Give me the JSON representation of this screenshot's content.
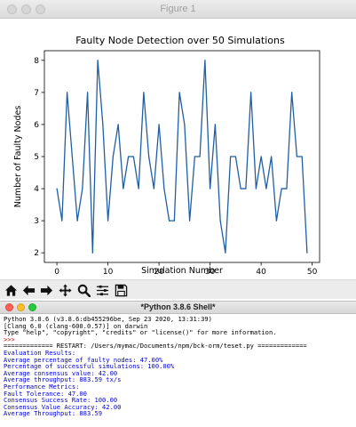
{
  "figure_window": {
    "title": "Figure 1",
    "toolbar": {
      "buttons": [
        {
          "name": "home-icon",
          "label": "Home"
        },
        {
          "name": "back-arrow-icon",
          "label": "Back"
        },
        {
          "name": "forward-arrow-icon",
          "label": "Forward"
        },
        {
          "name": "pan-icon",
          "label": "Pan"
        },
        {
          "name": "zoom-icon",
          "label": "Zoom"
        },
        {
          "name": "configure-subplots-icon",
          "label": "Configure subplots"
        },
        {
          "name": "save-icon",
          "label": "Save"
        }
      ]
    }
  },
  "chart_data": {
    "type": "line",
    "title": "Faulty Node Detection over 50 Simulations",
    "xlabel": "Simulation Number",
    "ylabel": "Number of Faulty Nodes",
    "xlim": [
      -2.45,
      51.45
    ],
    "ylim": [
      1.7,
      8.3
    ],
    "xticks": [
      0,
      10,
      20,
      30,
      40,
      50
    ],
    "yticks": [
      2,
      3,
      4,
      5,
      6,
      7,
      8
    ],
    "grid": false,
    "line_color": "#1f5fa3",
    "x": [
      0,
      1,
      2,
      3,
      4,
      5,
      6,
      7,
      8,
      9,
      10,
      11,
      12,
      13,
      14,
      15,
      16,
      17,
      18,
      19,
      20,
      21,
      22,
      23,
      24,
      25,
      26,
      27,
      28,
      29,
      30,
      31,
      32,
      33,
      34,
      35,
      36,
      37,
      38,
      39,
      40,
      41,
      42,
      43,
      44,
      45,
      46,
      47,
      48,
      49
    ],
    "values": [
      4,
      3,
      7,
      5,
      3,
      4,
      7,
      2,
      8,
      6,
      3,
      5,
      6,
      4,
      5,
      5,
      4,
      7,
      5,
      4,
      6,
      4,
      3,
      3,
      7,
      6,
      3,
      5,
      5,
      8,
      4,
      6,
      3,
      2,
      5,
      5,
      4,
      4,
      7,
      4,
      5,
      4,
      5,
      3,
      4,
      4,
      7,
      5,
      5,
      2
    ]
  },
  "shell_window": {
    "title": "*Python 3.8.6 Shell*",
    "lines": [
      {
        "text": "Python 3.8.6 (v3.8.6:db455296be, Sep 23 2020, 13:31:39)",
        "color": "black"
      },
      {
        "text": "[Clang 6.0 (clang-600.0.57)] on darwin",
        "color": "black"
      },
      {
        "text": "Type \"help\", \"copyright\", \"credits\" or \"license()\" for more information.",
        "color": "black"
      },
      {
        "text": ">>>",
        "color": "red"
      },
      {
        "text": "============= RESTART: /Users/mymac/Documents/npm/bck-orm/teset.py =============",
        "color": "black"
      },
      {
        "text": "Evaluation Results:",
        "color": "blue"
      },
      {
        "text": "Average percentage of faulty nodes: 47.00%",
        "color": "blue"
      },
      {
        "text": "Percentage of successful simulations: 100.00%",
        "color": "blue"
      },
      {
        "text": "Average consensus value: 42.00",
        "color": "blue"
      },
      {
        "text": "Average throughput: 883.59 tx/s",
        "color": "blue"
      },
      {
        "text": "Performance Metrics:",
        "color": "blue"
      },
      {
        "text": "Fault Tolerance: 47.00",
        "color": "blue"
      },
      {
        "text": "Consensus Success Rate: 100.00",
        "color": "blue"
      },
      {
        "text": "Consensus Value Accuracy: 42.00",
        "color": "blue"
      },
      {
        "text": "Average Throughput: 883.59",
        "color": "blue"
      }
    ]
  }
}
